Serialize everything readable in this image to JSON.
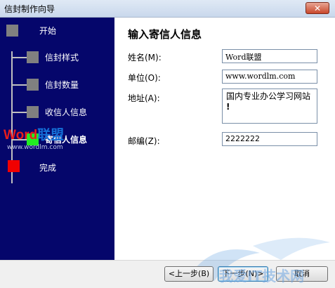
{
  "window": {
    "title": "信封制作向导",
    "close_glyph": "✕"
  },
  "steps": [
    {
      "label": "开始"
    },
    {
      "label": "信封样式"
    },
    {
      "label": "信封数量"
    },
    {
      "label": "收信人信息"
    },
    {
      "label": "寄信人信息",
      "current": true
    },
    {
      "label": "完成"
    }
  ],
  "watermarks": {
    "logo_word": "Word",
    "logo_cn": "联盟",
    "logo_url": "www.wordlm.com",
    "bottom_site": "我爱IT技术网"
  },
  "form": {
    "heading": "输入寄信人信息",
    "name": {
      "label": "姓名(M):",
      "value": "Word联盟"
    },
    "unit": {
      "label": "单位(O):",
      "value": "www.wordlm.com"
    },
    "address": {
      "label": "地址(A):",
      "value": "国内专业办公学习网站"
    },
    "zip": {
      "label": "邮编(Z):",
      "value": "2222222"
    }
  },
  "buttons": {
    "back": "<上一步(B)",
    "next": "下一步(N)>",
    "cancel": "取消"
  },
  "colors": {
    "sidebar_bg": "#05066b",
    "current_step_marker": "#22ee22",
    "finish_step_marker": "#f00000",
    "pending_step_marker": "#808080"
  }
}
